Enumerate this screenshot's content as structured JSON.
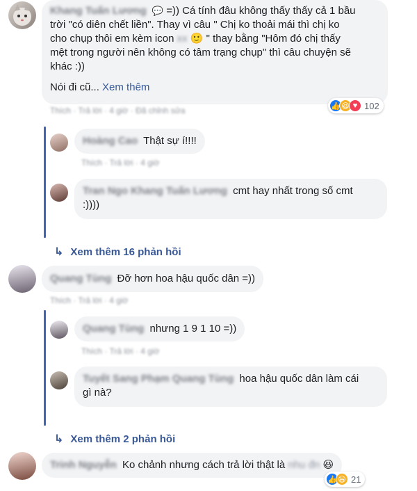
{
  "comments": [
    {
      "author": "Khang Tuấn Lương",
      "icon_glyph": "💬",
      "text_lines": [
        "=)) Cá tính đâu không thấy thấy cả 1 bầu",
        "trời \"có diên chết liền\". Thay vì câu \" Chị ko thoải mái thì chị ko",
        "cho chụp thôi em kèm icon",
        "\" thay bằng \"Hôm đó chị thấy",
        "mệt trong người nên không có tâm trạng chụp\" thì câu chuyện sẽ",
        "khác :))"
      ],
      "blur_inline": "xx",
      "emoji": "🙂",
      "see_more_prefix": "Nói đi cũ...",
      "see_more_link": "Xem thêm",
      "meta": "Thích · Trả lời · 4 giờ · Đã chỉnh sửa",
      "reactions_count": "102"
    },
    {
      "author": "Hoàng Cao",
      "text": "Thật sự í!!!!",
      "meta": "Thích · Trả lời · 4 giờ"
    },
    {
      "author": "Tran Ngo Khang Tuấn Lương",
      "text_lines": [
        "cmt hay nhất trong số cmt",
        ":))))"
      ],
      "meta": ""
    }
  ],
  "more_replies_1": "Xem thêm 16 phản hồi",
  "comment_2": {
    "author": "Quang Tùng",
    "text": "Đỡ hơn hoa hậu quốc dân =))",
    "meta": "Thích · Trả lời · 4 giờ"
  },
  "reply_2a": {
    "author": "Quang Tùng",
    "text": "nhưng 1 9 1 10 =))",
    "meta": "Thích · Trả lời · 4 giờ"
  },
  "reply_2b": {
    "author": "Tuyết Sang Phạm Quang Tùng",
    "text_lines": [
      "hoa hậu quốc dân làm cái",
      "gì nà?"
    ]
  },
  "more_replies_2": "Xem thêm 2 phản hồi",
  "comment_3": {
    "author": "Trinh Nguyễn",
    "text": "Ko chảnh nhưng cách trả lời thật là",
    "blur_tail": "nhu đn",
    "emoji": "😆",
    "reactions_count": "21"
  },
  "colors": {
    "accent": "#4267b2",
    "link": "#385898",
    "bubble": "#f2f3f5",
    "like": "#1877f2",
    "haha": "#f7b125",
    "love": "#f33e58"
  }
}
